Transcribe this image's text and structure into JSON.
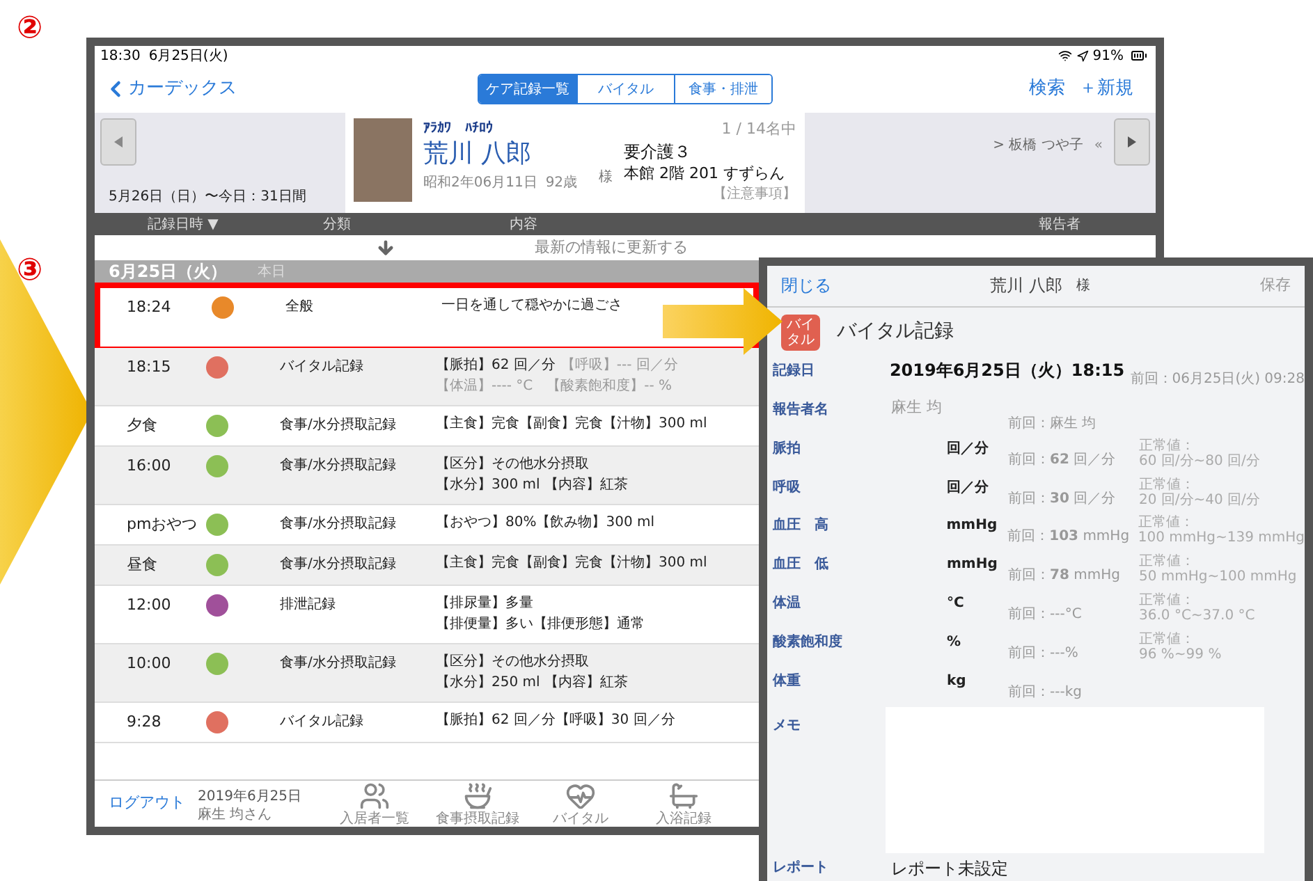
{
  "annotations": {
    "markers": [
      "②",
      "③"
    ]
  },
  "main_screen": {
    "status_bar": {
      "time": "18:30",
      "date": "6月25日(火)",
      "battery": "91%"
    },
    "nav": {
      "back": "カーデックス",
      "segments": [
        {
          "label": "ケア記録一覧",
          "selected": true
        },
        {
          "label": "バイタル",
          "selected": false
        },
        {
          "label": "食事・排泄",
          "selected": false
        }
      ],
      "actions": [
        "検索",
        "＋新規"
      ]
    },
    "resident": {
      "period": "5月26日（日）〜今日：31日間",
      "kana": "ｱﾗｶﾜ　ﾊﾁﾛｳ",
      "name": "荒川 八郎",
      "honorific": "様",
      "birthdate": "昭和2年06月11日",
      "age": "92歳",
      "position": "1 / 14名中",
      "care_level": "要介護３",
      "room": "本館 2階 201 すずらん",
      "notes": "【注意事項】",
      "next_resident": "> 板橋 つや子",
      "next_mark": "«"
    },
    "table": {
      "columns": [
        "記録日時 ▼",
        "分類",
        "内容",
        "報告者"
      ],
      "refresh": "最新の情報に更新する",
      "group": {
        "date": "6月25日（火）",
        "label": "本日"
      },
      "rows": [
        {
          "time": "18:24",
          "color": "#e8892a",
          "category": "全般",
          "highlighted": true,
          "content": [
            [
              {
                "text": "一日を通して穏やかに過ごさ",
                "dim": false
              }
            ]
          ]
        },
        {
          "time": "18:15",
          "color": "#e07060",
          "category": "バイタル記録",
          "highlighted": false,
          "content": [
            [
              {
                "text": "【脈拍】62 回／分",
                "dim": false
              },
              {
                "text": "【呼吸】--- 回／分",
                "dim": true
              }
            ],
            [
              {
                "text": "【体温】---- °C　【酸素飽和度】-- %",
                "dim": true
              }
            ]
          ]
        },
        {
          "time": "夕食",
          "color": "#8cbf55",
          "category": "食事/水分摂取記録",
          "highlighted": false,
          "content": [
            [
              {
                "text": "【主食】完食【副食】完食【汁物】300 ml",
                "dim": false
              }
            ]
          ]
        },
        {
          "time": "16:00",
          "color": "#8cbf55",
          "category": "食事/水分摂取記録",
          "highlighted": false,
          "content": [
            [
              {
                "text": "【区分】その他水分摂取",
                "dim": false
              }
            ],
            [
              {
                "text": "【水分】300 ml 【内容】紅茶",
                "dim": false
              }
            ]
          ]
        },
        {
          "time": "pmおやつ",
          "color": "#8cbf55",
          "category": "食事/水分摂取記録",
          "highlighted": false,
          "content": [
            [
              {
                "text": "【おやつ】80%【飲み物】300 ml",
                "dim": false
              }
            ]
          ]
        },
        {
          "time": "昼食",
          "color": "#8cbf55",
          "category": "食事/水分摂取記録",
          "highlighted": false,
          "content": [
            [
              {
                "text": "【主食】完食【副食】完食【汁物】300 ml",
                "dim": false
              }
            ]
          ]
        },
        {
          "time": "12:00",
          "color": "#a0509a",
          "category": "排泄記録",
          "highlighted": false,
          "content": [
            [
              {
                "text": "【排尿量】多量",
                "dim": false
              }
            ],
            [
              {
                "text": "【排便量】多い【排便形態】通常",
                "dim": false
              }
            ]
          ]
        },
        {
          "time": "10:00",
          "color": "#8cbf55",
          "category": "食事/水分摂取記録",
          "highlighted": false,
          "content": [
            [
              {
                "text": "【区分】その他水分摂取",
                "dim": false
              }
            ],
            [
              {
                "text": "【水分】250 ml 【内容】紅茶",
                "dim": false
              }
            ]
          ]
        },
        {
          "time": "9:28",
          "color": "#e07060",
          "category": "バイタル記録",
          "highlighted": false,
          "content": [
            [
              {
                "text": "【脈拍】62 回／分【呼吸】30 回／分",
                "dim": false
              }
            ]
          ]
        }
      ]
    },
    "tab_bar": {
      "logout": "ログアウト",
      "date": "2019年6月25日",
      "user": "麻生 均さん",
      "tabs": [
        {
          "label": "入居者一覧",
          "kind": "residents"
        },
        {
          "label": "食事摂取記録",
          "kind": "meal"
        },
        {
          "label": "バイタル",
          "kind": "vital"
        },
        {
          "label": "入浴記録",
          "kind": "bath"
        }
      ]
    }
  },
  "detail_panel": {
    "close": "閉じる",
    "title": "荒川 八郎",
    "honorific": "様",
    "save": {
      "label": "保存",
      "disabled": true
    },
    "badge": "バイタル",
    "heading": "バイタル記録",
    "fields": [
      {
        "kind": "date",
        "label": "記録日",
        "value": "2019年6月25日（火）18:15",
        "previous": "前回：06月25日(火) 09:28"
      },
      {
        "kind": "text",
        "label": "報告者名",
        "value": "麻生 均",
        "previous": "前回：麻生 均"
      },
      {
        "kind": "measure",
        "label": "脈拍",
        "unit": "回／分",
        "previous": "前回：**62** 回／分",
        "normal": [
          "正常値：",
          "60 回/分~80 回/分"
        ]
      },
      {
        "kind": "measure",
        "label": "呼吸",
        "unit": "回／分",
        "previous": "前回：**30** 回／分",
        "normal": [
          "正常値：",
          "20 回/分~40 回/分"
        ]
      },
      {
        "kind": "measure",
        "label": "血圧　高",
        "unit": "mmHg",
        "previous": "前回：**103** mmHg",
        "normal": [
          "正常値：",
          "100 mmHg~139 mmHg"
        ]
      },
      {
        "kind": "measure",
        "label": "血圧　低",
        "unit": "mmHg",
        "previous": "前回：**78** mmHg",
        "normal": [
          "正常値：",
          "50 mmHg~100 mmHg"
        ]
      },
      {
        "kind": "measure",
        "label": "体温",
        "unit": "°C",
        "previous": "前回：---°C",
        "normal": [
          "正常値：",
          "36.0 °C~37.0 °C"
        ]
      },
      {
        "kind": "measure",
        "label": "酸素飽和度",
        "unit": "%",
        "previous": "前回：---%",
        "normal": [
          "正常値：",
          "96 %~99 %"
        ]
      },
      {
        "kind": "measure",
        "label": "体重",
        "unit": "kg",
        "previous": "前回：---kg"
      }
    ],
    "memo": {
      "label": "メモ"
    },
    "report": {
      "label": "レポート",
      "value": "レポート未設定"
    }
  }
}
